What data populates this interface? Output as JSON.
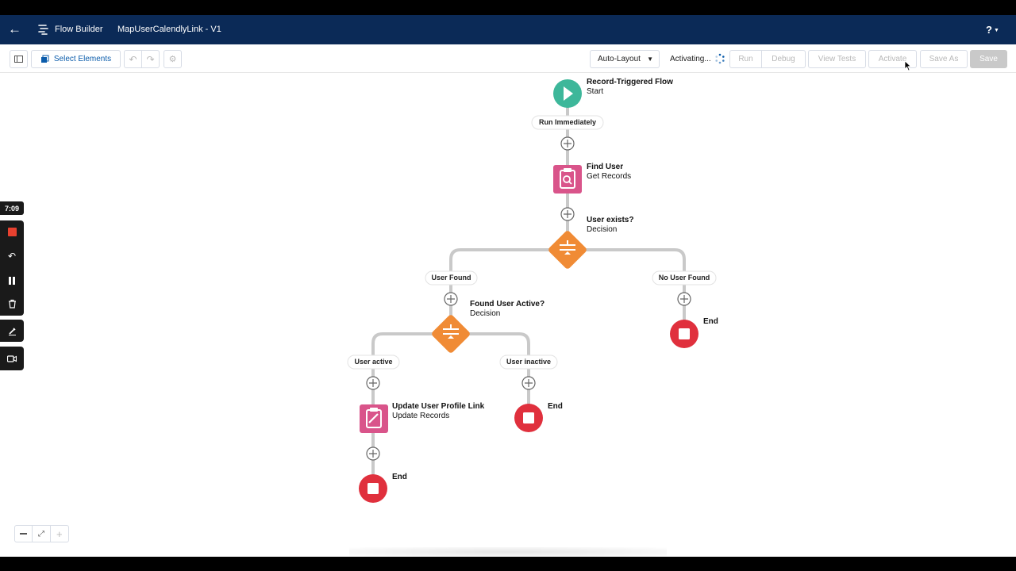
{
  "header": {
    "app_name": "Flow Builder",
    "flow_name": "MapUserCalendlyLink - V1",
    "help": "?"
  },
  "toolbar": {
    "select_elements": "Select Elements",
    "auto_layout": "Auto-Layout",
    "activating": "Activating...",
    "run": "Run",
    "debug": "Debug",
    "view_tests": "View Tests",
    "activate": "Activate",
    "save_as": "Save As",
    "save": "Save"
  },
  "recorder": {
    "time": "7:09"
  },
  "flow": {
    "start": {
      "title": "Record-Triggered Flow",
      "subtitle": "Start"
    },
    "run_immediately": "Run Immediately",
    "find_user": {
      "title": "Find User",
      "subtitle": "Get Records"
    },
    "user_exists": {
      "title": "User exists?",
      "subtitle": "Decision"
    },
    "user_found": "User Found",
    "no_user_found": "No User Found",
    "found_user_active": {
      "title": "Found User Active?",
      "subtitle": "Decision"
    },
    "user_active": "User active",
    "user_inactive": "User inactive",
    "update_profile": {
      "title": "Update User Profile Link",
      "subtitle": "Update Records"
    },
    "end_label": "End"
  },
  "colors": {
    "header_bg": "#0b2a57",
    "start_green": "#3db79a",
    "record_pink": "#d9548a",
    "decision_orange": "#f08b35",
    "end_red": "#e0303d",
    "brand_blue": "#0b5cab"
  }
}
